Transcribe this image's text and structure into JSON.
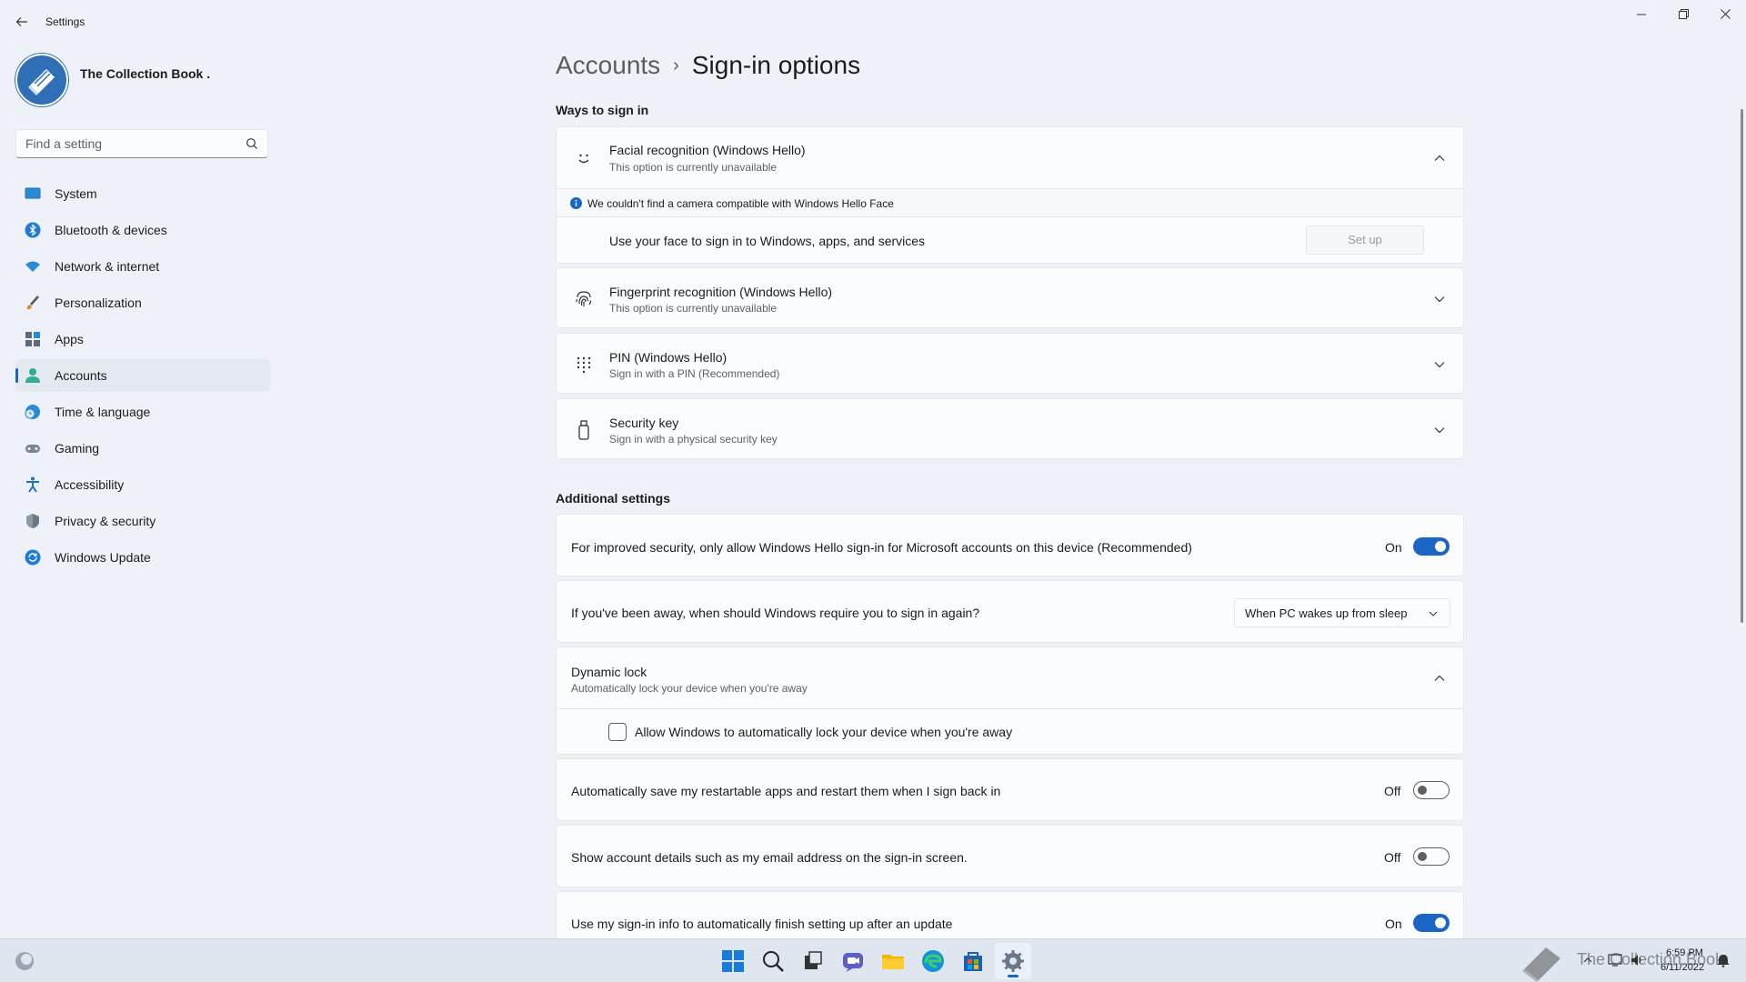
{
  "window": {
    "title": "Settings",
    "back_label": "←",
    "minimize": "—",
    "maximize": "❐",
    "close": "✕"
  },
  "profile": {
    "name": "The Collection Book ."
  },
  "search": {
    "placeholder": "Find a setting"
  },
  "sidebar": {
    "items": [
      {
        "label": "System",
        "icon": "monitor-icon"
      },
      {
        "label": "Bluetooth & devices",
        "icon": "bluetooth-icon"
      },
      {
        "label": "Network & internet",
        "icon": "wifi-icon"
      },
      {
        "label": "Personalization",
        "icon": "brush-icon"
      },
      {
        "label": "Apps",
        "icon": "apps-icon"
      },
      {
        "label": "Accounts",
        "icon": "person-icon",
        "active": true
      },
      {
        "label": "Time & language",
        "icon": "globe-clock-icon"
      },
      {
        "label": "Gaming",
        "icon": "gamepad-icon"
      },
      {
        "label": "Accessibility",
        "icon": "accessibility-icon"
      },
      {
        "label": "Privacy & security",
        "icon": "shield-icon"
      },
      {
        "label": "Windows Update",
        "icon": "update-icon"
      }
    ]
  },
  "breadcrumb": {
    "parent": "Accounts",
    "separator": "›",
    "current": "Sign-in options"
  },
  "ways_section": {
    "title": "Ways to sign in",
    "face": {
      "title": "Facial recognition (Windows Hello)",
      "subtitle": "This option is currently unavailable",
      "info": "We couldn't find a camera compatible with Windows Hello Face",
      "description": "Use your face to sign in to Windows, apps, and services",
      "button": "Set up"
    },
    "fingerprint": {
      "title": "Fingerprint recognition (Windows Hello)",
      "subtitle": "This option is currently unavailable"
    },
    "pin": {
      "title": "PIN (Windows Hello)",
      "subtitle": "Sign in with a PIN (Recommended)"
    },
    "security_key": {
      "title": "Security key",
      "subtitle": "Sign in with a physical security key"
    }
  },
  "additional_section": {
    "title": "Additional settings",
    "hello_only": {
      "label": "For improved security, only allow Windows Hello sign-in for Microsoft accounts on this device (Recommended)",
      "state": "On"
    },
    "require_signin": {
      "label": "If you've been away, when should Windows require you to sign in again?",
      "selected": "When PC wakes up from sleep"
    },
    "dynamic_lock": {
      "title": "Dynamic lock",
      "subtitle": "Automatically lock your device when you're away",
      "checkbox_label": "Allow Windows to automatically lock your device when you're away"
    },
    "restart_apps": {
      "label": "Automatically save my restartable apps and restart them when I sign back in",
      "state": "Off"
    },
    "account_details": {
      "label": "Show account details such as my email address on the sign-in screen.",
      "state": "Off"
    },
    "finish_setup": {
      "label": "Use my sign-in info to automatically finish setting up after an update",
      "state": "On"
    }
  },
  "taskbar": {
    "time": "6:59 PM",
    "date": "6/11/2022",
    "watermark": "The Collection Book"
  },
  "colors": {
    "accent": "#1a66c6",
    "background": "#eef2f8",
    "card": "#fbfcfe"
  }
}
